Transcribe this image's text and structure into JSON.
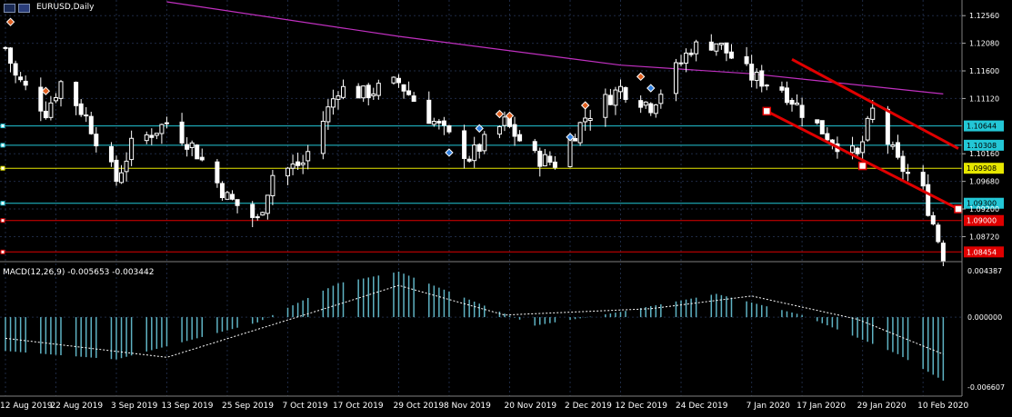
{
  "window": {
    "title": "EURUSD,Daily",
    "icons": [
      "chart-window-icon",
      "symbol-flag-icon"
    ]
  },
  "colors": {
    "background": "#000000",
    "grid": "#1e2a44",
    "candle": "#ffffff",
    "ma_line": "#c030c0",
    "channel": "#e00000",
    "cyan_level": "#23c7d6",
    "yellow_level": "#e6e600",
    "red_level": "#e00000",
    "macd_hist": "#5fb3c4",
    "macd_signal": "#ffffff"
  },
  "price_axis": {
    "ticks": [
      "1.12560",
      "1.12080",
      "1.11600",
      "1.11120",
      "1.10160",
      "1.09680",
      "1.09200",
      "1.08720"
    ],
    "labels": [
      {
        "text": "1.10644",
        "color": "#23c7d6",
        "text_color": "#000000"
      },
      {
        "text": "1.10308",
        "color": "#23c7d6",
        "text_color": "#000000"
      },
      {
        "text": "1.09908",
        "color": "#e6e600",
        "text_color": "#000000"
      },
      {
        "text": "1.09300",
        "color": "#23c7d6",
        "text_color": "#000000"
      },
      {
        "text": "1.09000",
        "color": "#e00000",
        "text_color": "#ffffff"
      },
      {
        "text": "1.08454",
        "color": "#e00000",
        "text_color": "#ffffff"
      }
    ]
  },
  "macd": {
    "label": "MACD(12,26,9) -0.005653 -0.003442",
    "ticks": [
      "0.004387",
      "0.000000",
      "-0.006607"
    ]
  },
  "time_axis": {
    "labels": [
      "12 Aug 2019",
      "22 Aug 2019",
      "3 Sep 2019",
      "13 Sep 2019",
      "25 Sep 2019",
      "7 Oct 2019",
      "17 Oct 2019",
      "29 Oct 2019",
      "8 Nov 2019",
      "20 Nov 2019",
      "2 Dec 2019",
      "12 Dec 2019",
      "24 Dec 2019",
      "7 Jan 2020",
      "17 Jan 2020",
      "29 Jan 2020",
      "10 Feb 2020"
    ]
  },
  "chart_data": {
    "type": "candlestick",
    "symbol": "EURUSD",
    "timeframe": "Daily",
    "y_range": [
      1.0838,
      1.128
    ],
    "x_range_dates": [
      "2019-08-12",
      "2020-02-17"
    ],
    "close_path": [
      {
        "date": "2019-08-12",
        "close": 1.12
      },
      {
        "date": "2019-08-14",
        "close": 1.115
      },
      {
        "date": "2019-08-20",
        "close": 1.109
      },
      {
        "date": "2019-08-23",
        "close": 1.114
      },
      {
        "date": "2019-08-28",
        "close": 1.108
      },
      {
        "date": "2019-09-03",
        "close": 1.097
      },
      {
        "date": "2019-09-06",
        "close": 1.103
      },
      {
        "date": "2019-09-13",
        "close": 1.107
      },
      {
        "date": "2019-09-18",
        "close": 1.103
      },
      {
        "date": "2019-09-25",
        "close": 1.094
      },
      {
        "date": "2019-10-01",
        "close": 1.09
      },
      {
        "date": "2019-10-04",
        "close": 1.098
      },
      {
        "date": "2019-10-10",
        "close": 1.1
      },
      {
        "date": "2019-10-17",
        "close": 1.113
      },
      {
        "date": "2019-10-22",
        "close": 1.112
      },
      {
        "date": "2019-10-29",
        "close": 1.114
      },
      {
        "date": "2019-11-04",
        "close": 1.108
      },
      {
        "date": "2019-11-12",
        "close": 1.101
      },
      {
        "date": "2019-11-19",
        "close": 1.107
      },
      {
        "date": "2019-11-25",
        "close": 1.101
      },
      {
        "date": "2019-11-29",
        "close": 1.1
      },
      {
        "date": "2019-12-05",
        "close": 1.108
      },
      {
        "date": "2019-12-12",
        "close": 1.113
      },
      {
        "date": "2019-12-18",
        "close": 1.11
      },
      {
        "date": "2019-12-26",
        "close": 1.12
      },
      {
        "date": "2019-12-31",
        "close": 1.121
      },
      {
        "date": "2020-01-07",
        "close": 1.115
      },
      {
        "date": "2020-01-13",
        "close": 1.113
      },
      {
        "date": "2020-01-17",
        "close": 1.109
      },
      {
        "date": "2020-01-23",
        "close": 1.104
      },
      {
        "date": "2020-01-28",
        "close": 1.101
      },
      {
        "date": "2020-01-31",
        "close": 1.109
      },
      {
        "date": "2020-02-05",
        "close": 1.1
      },
      {
        "date": "2020-02-10",
        "close": 1.095
      },
      {
        "date": "2020-02-14",
        "close": 1.084
      }
    ],
    "moving_average": [
      {
        "date": "2019-09-13",
        "value": 1.128
      },
      {
        "date": "2019-10-29",
        "value": 1.122
      },
      {
        "date": "2019-12-12",
        "value": 1.117
      },
      {
        "date": "2020-01-07",
        "value": 1.1155
      },
      {
        "date": "2020-02-14",
        "value": 1.112
      }
    ],
    "channel_upper": [
      {
        "date": "2020-01-15",
        "price": 1.118
      },
      {
        "date": "2020-02-17",
        "price": 1.1025
      }
    ],
    "channel_lower": [
      {
        "date": "2020-01-10",
        "price": 1.109
      },
      {
        "date": "2020-02-17",
        "price": 1.092
      }
    ],
    "horizontal_levels": [
      {
        "price": 1.10644,
        "color": "#23c7d6"
      },
      {
        "price": 1.10308,
        "color": "#23c7d6"
      },
      {
        "price": 1.09908,
        "color": "#e6e600"
      },
      {
        "price": 1.093,
        "color": "#23c7d6"
      },
      {
        "price": 1.09,
        "color": "#e00000"
      },
      {
        "price": 1.08454,
        "color": "#e00000"
      }
    ],
    "macd_series": {
      "name": "MACD(12,26,9)",
      "histogram": [
        {
          "date": "2019-08-12",
          "value": -0.0032
        },
        {
          "date": "2019-09-03",
          "value": -0.004
        },
        {
          "date": "2019-10-01",
          "value": -0.0005
        },
        {
          "date": "2019-10-17",
          "value": 0.0032
        },
        {
          "date": "2019-10-29",
          "value": 0.0043
        },
        {
          "date": "2019-11-25",
          "value": -0.0008
        },
        {
          "date": "2019-12-12",
          "value": 0.0005
        },
        {
          "date": "2019-12-31",
          "value": 0.0022
        },
        {
          "date": "2020-01-17",
          "value": 0.0002
        },
        {
          "date": "2020-02-05",
          "value": -0.0035
        },
        {
          "date": "2020-02-14",
          "value": -0.006
        }
      ],
      "signal": [
        {
          "date": "2019-08-12",
          "value": -0.002
        },
        {
          "date": "2019-09-13",
          "value": -0.0038
        },
        {
          "date": "2019-10-17",
          "value": 0.0012
        },
        {
          "date": "2019-10-29",
          "value": 0.003
        },
        {
          "date": "2019-11-19",
          "value": 0.0002
        },
        {
          "date": "2019-12-18",
          "value": 0.0008
        },
        {
          "date": "2020-01-07",
          "value": 0.002
        },
        {
          "date": "2020-01-28",
          "value": -0.0002
        },
        {
          "date": "2020-02-14",
          "value": -0.0035
        }
      ],
      "last_macd": -0.005653,
      "last_signal": -0.003442
    }
  }
}
